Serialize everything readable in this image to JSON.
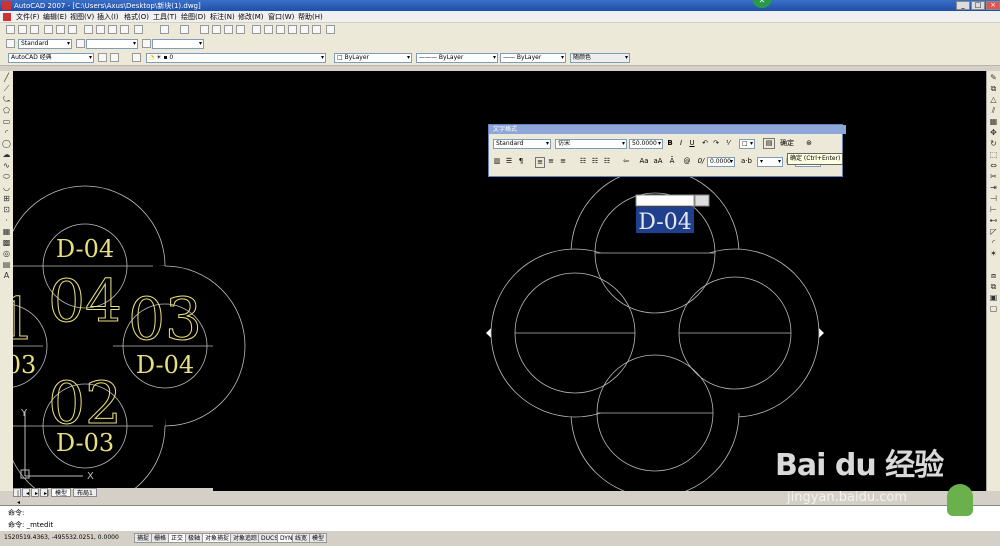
{
  "window": {
    "title": "AutoCAD 2007 - [C:\\Users\\Axus\\Desktop\\新块(1).dwg]",
    "controls": [
      "_",
      "□",
      "×"
    ]
  },
  "menu": [
    "文件(F)",
    "编辑(E)",
    "视图(V)",
    "插入(I)",
    "格式(O)",
    "工具(T)",
    "绘图(D)",
    "标注(N)",
    "修改(M)",
    "窗口(W)",
    "帮助(H)"
  ],
  "styles_toolbar": {
    "text_style": "Standard",
    "workspace": "AutoCAD 经典",
    "layer": "0",
    "color": "ByLayer",
    "linetype": "ByLayer",
    "lineweight": "ByLayer",
    "plotstyle": "随颜色"
  },
  "text_formatting": {
    "title": "文字格式",
    "style": "Standard",
    "font": "仿宋",
    "height": "50.0000",
    "bold": "B",
    "italic": "I",
    "underline": "U",
    "ok_label": "确定",
    "oblique": "0.0000",
    "width_factor": "1.0000",
    "tooltip": "确定 (Ctrl+Enter)"
  },
  "drawing": {
    "left_labels": {
      "top_small": "D-04",
      "top_big": "04",
      "left_big": "1",
      "left_small": "03",
      "right_big": "03",
      "right_small": "D-04",
      "bottom_big": "02",
      "bottom_small": "D-03"
    },
    "editing_text": "D-04",
    "ucs_x": "X",
    "ucs_y": "Y"
  },
  "tabs": [
    "模型",
    "布局1"
  ],
  "command": {
    "line1": "命令:",
    "line2": "命令: _mtedit"
  },
  "status": {
    "coords": "1520519.4363, -495532.0251, 0.0000",
    "buttons": [
      "捕捉",
      "栅格",
      "正交",
      "极轴",
      "对象捕捉",
      "对象追踪",
      "DUCS",
      "DYN",
      "线宽",
      "模型"
    ]
  },
  "watermark": {
    "brand": "Bai du 经验",
    "url": "jingyan.baidu.com"
  },
  "colors": {
    "canvas": "#000000",
    "yellow": "#ffff00",
    "white": "#ffffff",
    "highlight": "#1f3f8f"
  }
}
